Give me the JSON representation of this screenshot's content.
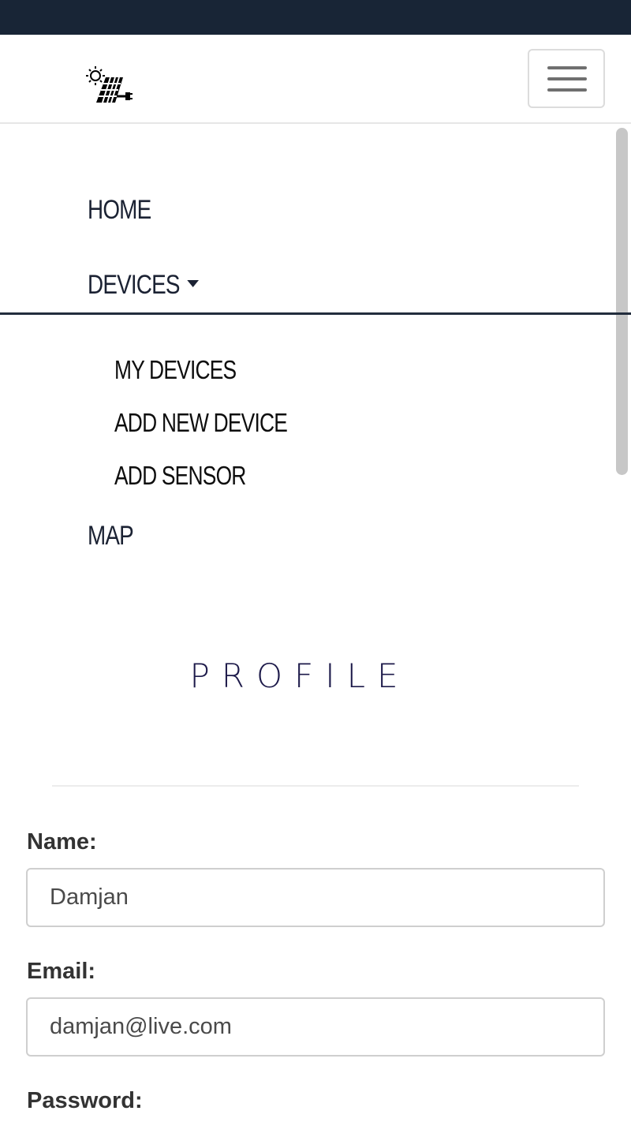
{
  "app": {
    "logo_icon": "solar-panel-plug-icon"
  },
  "navbar": {
    "toggle_icon": "hamburger-menu-icon"
  },
  "menu": {
    "home": "Home",
    "devices": "Devices",
    "devices_caret_icon": "caret-down-icon",
    "devices_submenu": [
      "My Devices",
      "Add New Device",
      "Add Sensor"
    ],
    "map": "Map"
  },
  "page": {
    "title": "PROFILE"
  },
  "form": {
    "name_label": "Name:",
    "name_value": "Damjan",
    "email_label": "Email:",
    "email_value": "damjan@live.com",
    "password_label": "Password:"
  },
  "colors": {
    "top_strip": "#182536",
    "nav_text": "#1b2233",
    "title": "#1d1a4a"
  }
}
